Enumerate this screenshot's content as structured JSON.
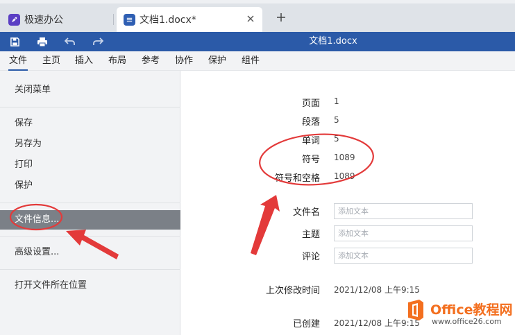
{
  "tabs": [
    {
      "label": "极速办公",
      "icon": "rocket-icon"
    },
    {
      "label": "文档1.docx*",
      "icon": "document-icon"
    }
  ],
  "toolbar": {
    "doc_title": "文档1.docx",
    "accent_color": "#2b5aa8"
  },
  "menu": {
    "items": [
      "文件",
      "主页",
      "插入",
      "布局",
      "参考",
      "协作",
      "保护",
      "组件"
    ],
    "active": "文件"
  },
  "sidebar": {
    "items": [
      "关闭菜单",
      "保存",
      "另存为",
      "打印",
      "保护",
      "文件信息...",
      "高级设置...",
      "打开文件所在位置"
    ],
    "selected": "文件信息..."
  },
  "info": {
    "stats": [
      {
        "label": "页面",
        "value": "1"
      },
      {
        "label": "段落",
        "value": "5"
      },
      {
        "label": "单词",
        "value": "5"
      },
      {
        "label": "符号",
        "value": "1089"
      },
      {
        "label": "符号和空格",
        "value": "1089"
      }
    ],
    "fields": [
      {
        "label": "文件名",
        "placeholder": "添加文本"
      },
      {
        "label": "主题",
        "placeholder": "添加文本"
      },
      {
        "label": "评论",
        "placeholder": "添加文本"
      }
    ],
    "last_modified_label": "上次修改时间",
    "last_modified_value": "2021/12/08 上午9:15",
    "created_label": "已创建",
    "created_value": "2021/12/08 上午9:15"
  },
  "watermark": {
    "title": "Office教程网",
    "url": "www.office26.com"
  }
}
